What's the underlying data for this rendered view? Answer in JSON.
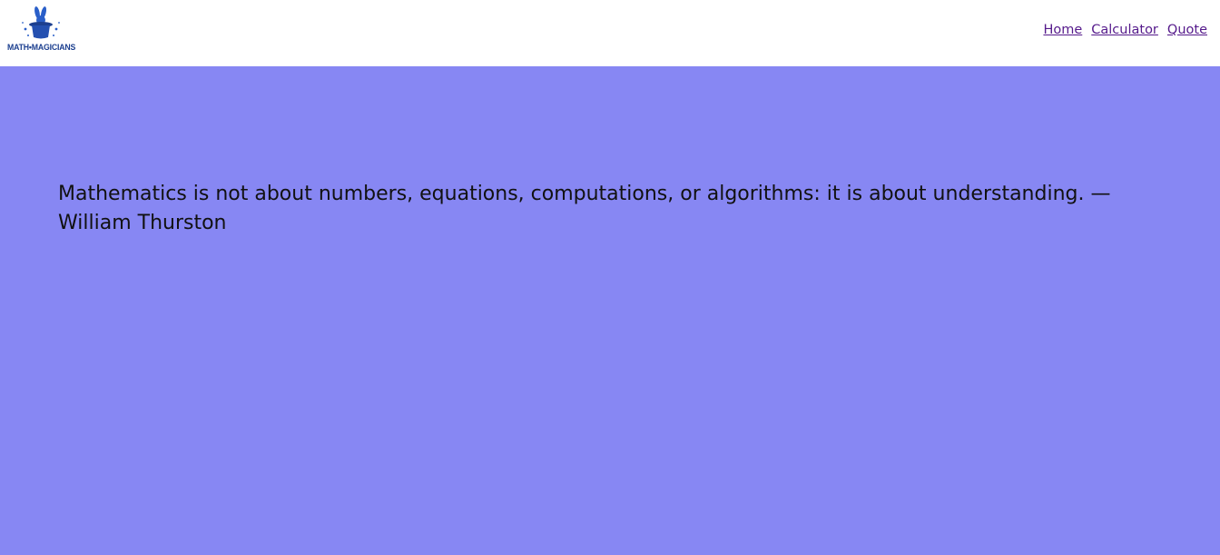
{
  "header": {
    "logo_text": "MATH•MAGICIANS",
    "logo_icon": "magic-hat-rabbit-icon",
    "nav": [
      {
        "label": "Home"
      },
      {
        "label": "Calculator"
      },
      {
        "label": "Quote"
      }
    ]
  },
  "main": {
    "quote": "Mathematics is not about numbers, equations, computations, or algorithms: it is about understanding. — William Thurston"
  },
  "colors": {
    "background": "#8787f3",
    "header": "#ffffff",
    "link": "#551a8b",
    "logo": "#1c3f8f"
  }
}
